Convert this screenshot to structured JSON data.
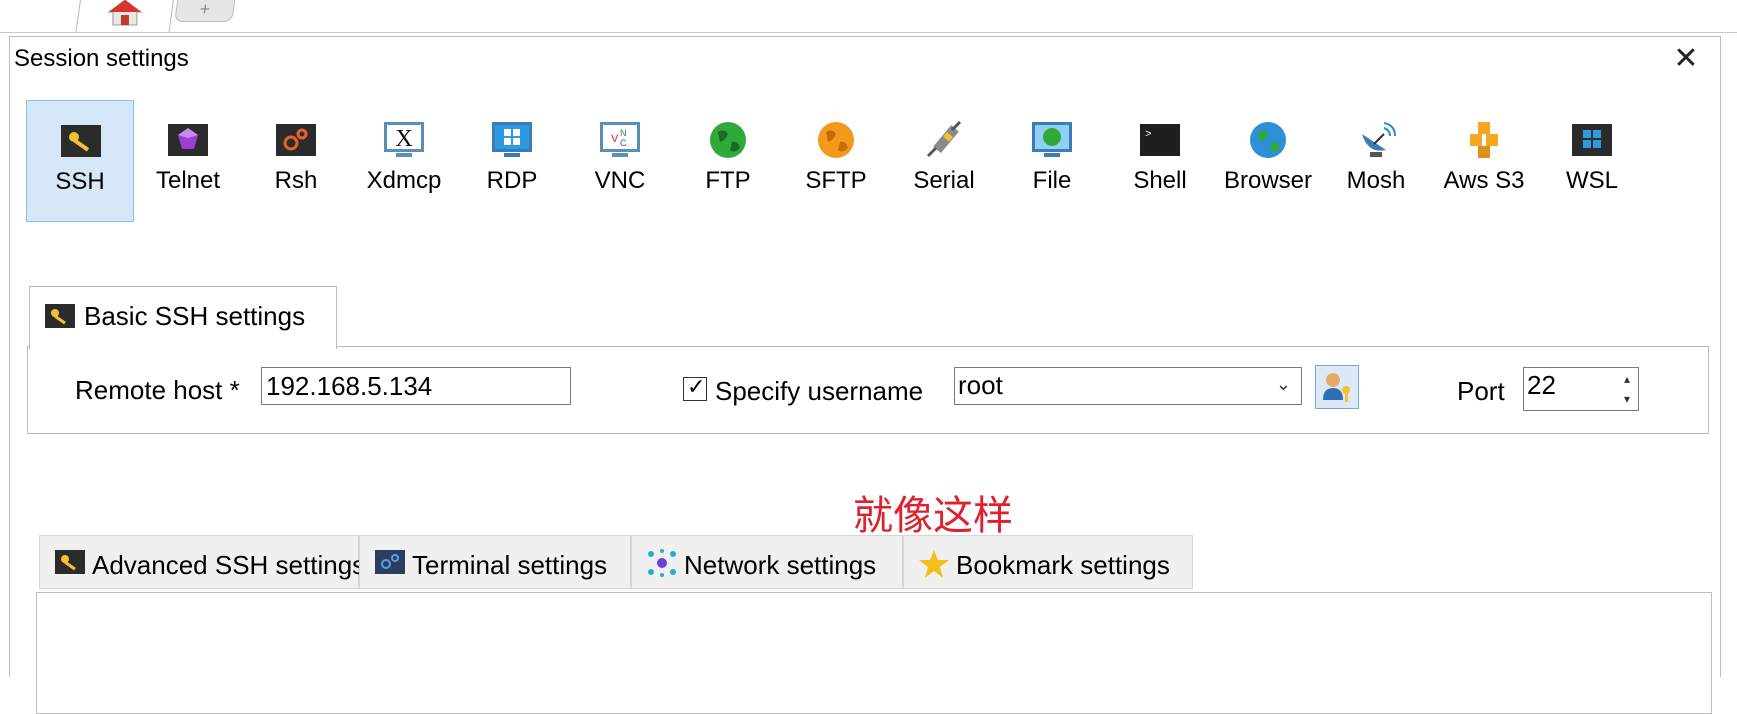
{
  "tabs": {
    "home_icon": "home-icon",
    "new_tab_icon": "plus-icon",
    "new_tab_glyph": "+"
  },
  "dialog": {
    "title": "Session settings",
    "close_glyph": "✕"
  },
  "session_types": [
    {
      "label": "SSH",
      "icon": "key-icon",
      "selected": true
    },
    {
      "label": "Telnet",
      "icon": "purple-gem-icon"
    },
    {
      "label": "Rsh",
      "icon": "gears-icon"
    },
    {
      "label": "Xdmcp",
      "icon": "x-monitor-icon"
    },
    {
      "label": "RDP",
      "icon": "windows-monitor-icon"
    },
    {
      "label": "VNC",
      "icon": "vnc-monitor-icon"
    },
    {
      "label": "FTP",
      "icon": "green-globe-icon"
    },
    {
      "label": "SFTP",
      "icon": "orange-globe-icon"
    },
    {
      "label": "Serial",
      "icon": "serial-plug-icon"
    },
    {
      "label": "File",
      "icon": "file-monitor-icon"
    },
    {
      "label": "Shell",
      "icon": "terminal-icon"
    },
    {
      "label": "Browser",
      "icon": "blue-globe-icon"
    },
    {
      "label": "Mosh",
      "icon": "satellite-dish-icon"
    },
    {
      "label": "Aws S3",
      "icon": "aws-cubes-icon"
    },
    {
      "label": "WSL",
      "icon": "windows-terminal-icon"
    }
  ],
  "basic": {
    "tab_label": "Basic SSH settings",
    "remote_host_label": "Remote host *",
    "remote_host_value": "192.168.5.134",
    "specify_username_label": "Specify username",
    "specify_username_checked": true,
    "username_value": "root",
    "port_label": "Port",
    "port_value": "22"
  },
  "annotation": "就像这样",
  "advanced_tabs": [
    {
      "label": "Advanced SSH settings",
      "icon": "key-icon"
    },
    {
      "label": "Terminal settings",
      "icon": "gears-icon"
    },
    {
      "label": "Network settings",
      "icon": "network-nodes-icon"
    },
    {
      "label": "Bookmark settings",
      "icon": "star-icon"
    }
  ],
  "colors": {
    "selected_bg": "#d6e8f8",
    "selected_border": "#8cc0ea",
    "annotation": "#e0202c"
  }
}
